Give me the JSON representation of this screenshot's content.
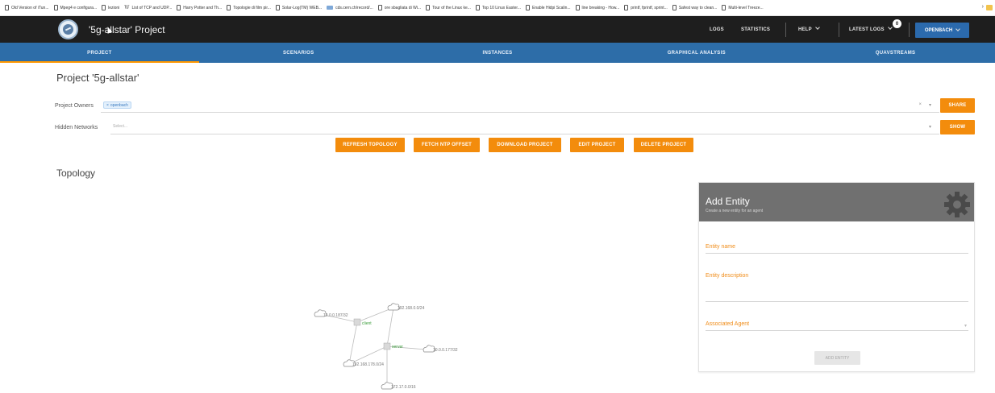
{
  "bookmarks": [
    {
      "label": "Old Version of iTun..."
    },
    {
      "label": "Mpeg4 e configura..."
    },
    {
      "label": "lezioni"
    },
    {
      "label": "List of TCP and UDP..."
    },
    {
      "label": "Harry Potter and Th..."
    },
    {
      "label": "Topologie di film pir..."
    },
    {
      "label": "Solar-Log(TM) WEB..."
    },
    {
      "label": "cds.cern.ch/record/..."
    },
    {
      "label": "ore sbagliata di Wi..."
    },
    {
      "label": "Tour of the Linux ke..."
    },
    {
      "label": "Top 10 Linux Easter..."
    },
    {
      "label": "Enable Hidpi Scalin..."
    },
    {
      "label": "line breaking - How..."
    },
    {
      "label": "printf, fprintf, sprint..."
    },
    {
      "label": "Safest way to clean..."
    },
    {
      "label": "Multi-level Treeze..."
    }
  ],
  "header": {
    "title": "'5g-allstar' Project",
    "logs": "LOGS",
    "statistics": "STATISTICS",
    "help": "HELP",
    "latest_logs": "LATEST LOGS",
    "badge_count": "0",
    "user": "OPENBACH"
  },
  "tabs": [
    {
      "label": "PROJECT",
      "active": true
    },
    {
      "label": "SCENARIOS"
    },
    {
      "label": "INSTANCES"
    },
    {
      "label": "GRAPHICAL ANALYSIS"
    },
    {
      "label": "QUAVSTREAMS"
    }
  ],
  "project": {
    "title": "Project '5g-allstar'",
    "owners_label": "Project Owners",
    "owner_chip": "openbach",
    "owners_clear": "×",
    "owners_caret": "▾",
    "share": "SHARE",
    "hidden_label": "Hidden Networks",
    "hidden_placeholder": "Select...",
    "hidden_caret": "▾",
    "show": "SHOW",
    "actions": {
      "refresh": "REFRESH TOPOLOGY",
      "fetch_ntp": "FETCH NTP OFFSET",
      "download": "DOWNLOAD PROJECT",
      "edit": "EDIT PROJECT",
      "delete": "DELETE PROJECT"
    }
  },
  "topology": {
    "title": "Topology",
    "nodes": {
      "client": "client",
      "server": "server",
      "net1": "10.0.0.187/32",
      "net2": "192.168.0.0/24",
      "net3": "10.0.0.177/32",
      "net4": "192.168.178.0/24",
      "net5": "172.17.0.0/16"
    }
  },
  "add_entity": {
    "title": "Add Entity",
    "subtitle": "Create a new entity for an agent",
    "name_label": "Entity name",
    "description_label": "Entity description",
    "agent_label": "Associated Agent",
    "agent_caret": "▾",
    "button": "ADD ENTITY"
  },
  "colors": {
    "header_bg": "#1e1e1e",
    "nav_bg": "#2d6da8",
    "accent_orange": "#f38c0c",
    "primary_blue": "#2b6aad",
    "card_header": "#707070"
  }
}
